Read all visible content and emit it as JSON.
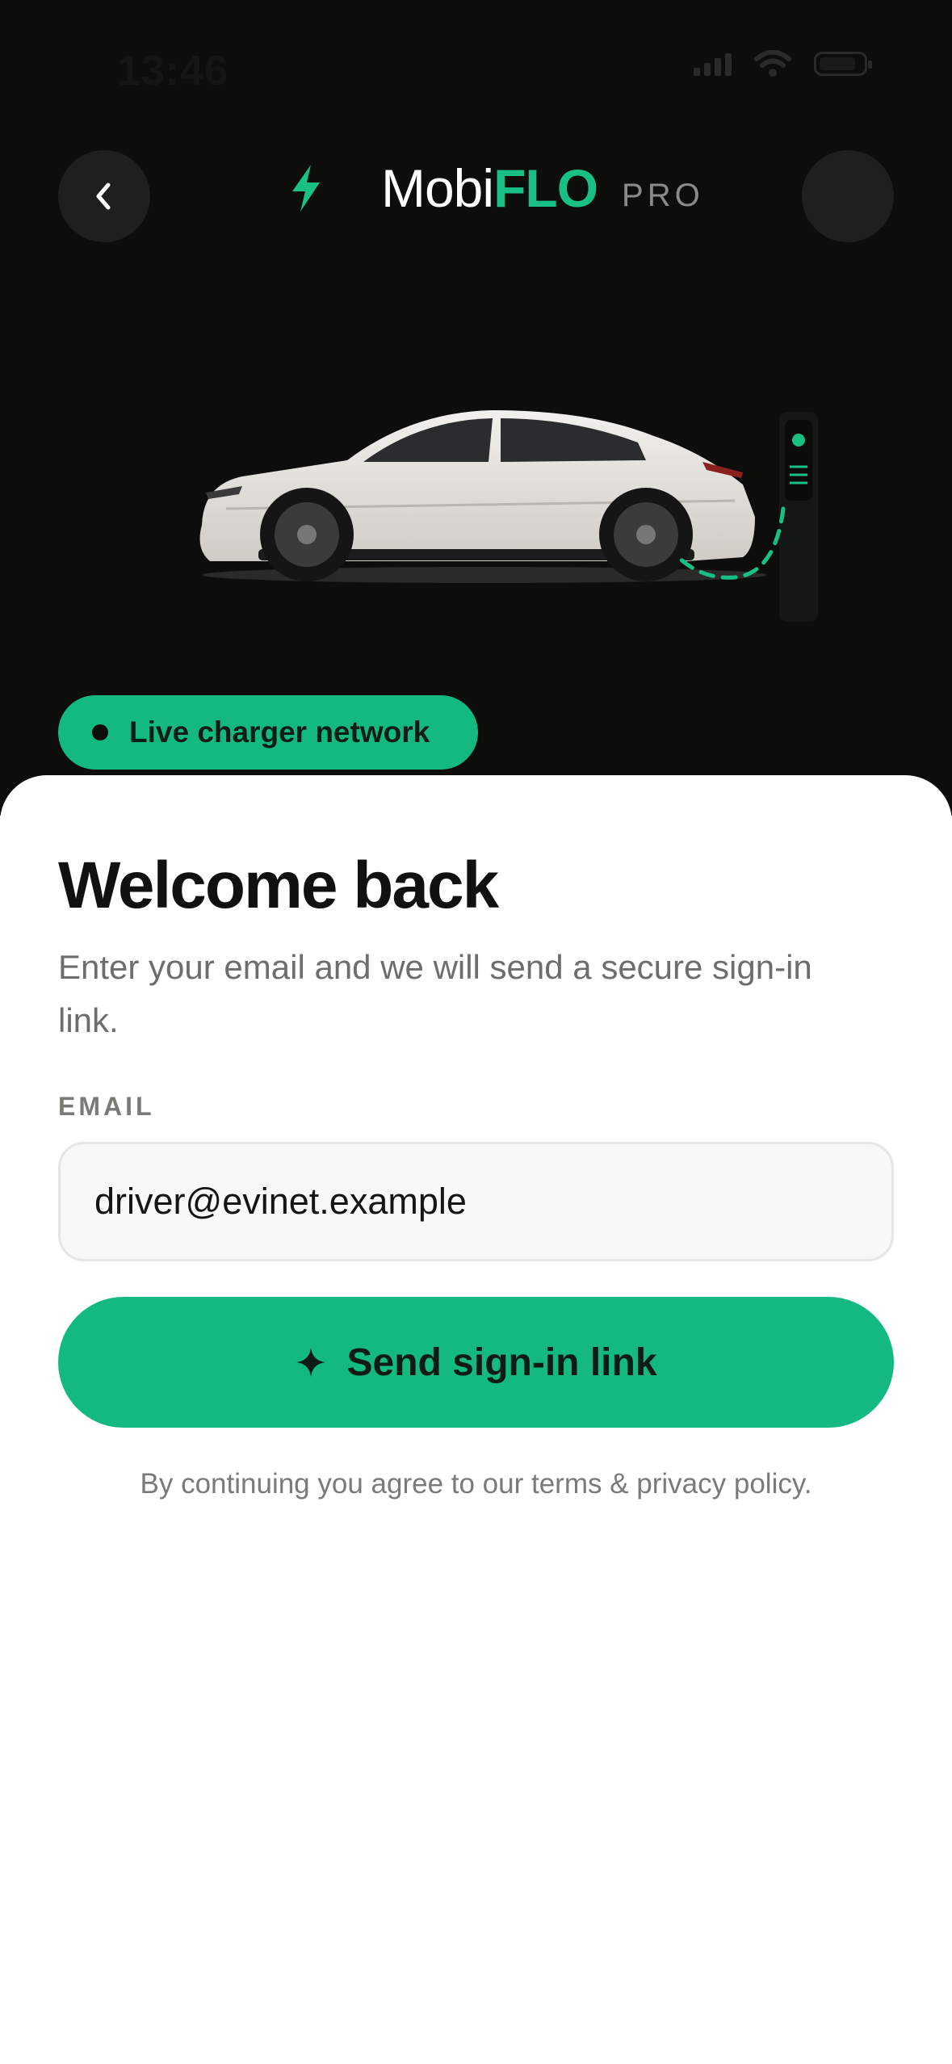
{
  "status_bar": {
    "time": "13:46"
  },
  "header": {
    "brand_prefix": "Mobi",
    "brand_accent": "FLO",
    "brand_suffix": "PRO",
    "back_icon": "chevron-left-icon",
    "logo_icon": "lightning-bolt-icon"
  },
  "hero": {
    "badge_label": "Live charger network"
  },
  "login": {
    "title": "Welcome back",
    "subtitle": "Enter your email and we will send a secure sign-in link.",
    "email_label": "EMAIL",
    "email_value": "driver@evinet.example",
    "submit_label": "Send sign-in link",
    "submit_icon": "sparkle-icon",
    "legal": "By continuing you agree to our terms & privacy policy."
  },
  "colors": {
    "accent": "#14b981",
    "hero_bg": "#0d0d0c",
    "text_primary": "#111111",
    "text_muted": "#6d6d6a"
  }
}
